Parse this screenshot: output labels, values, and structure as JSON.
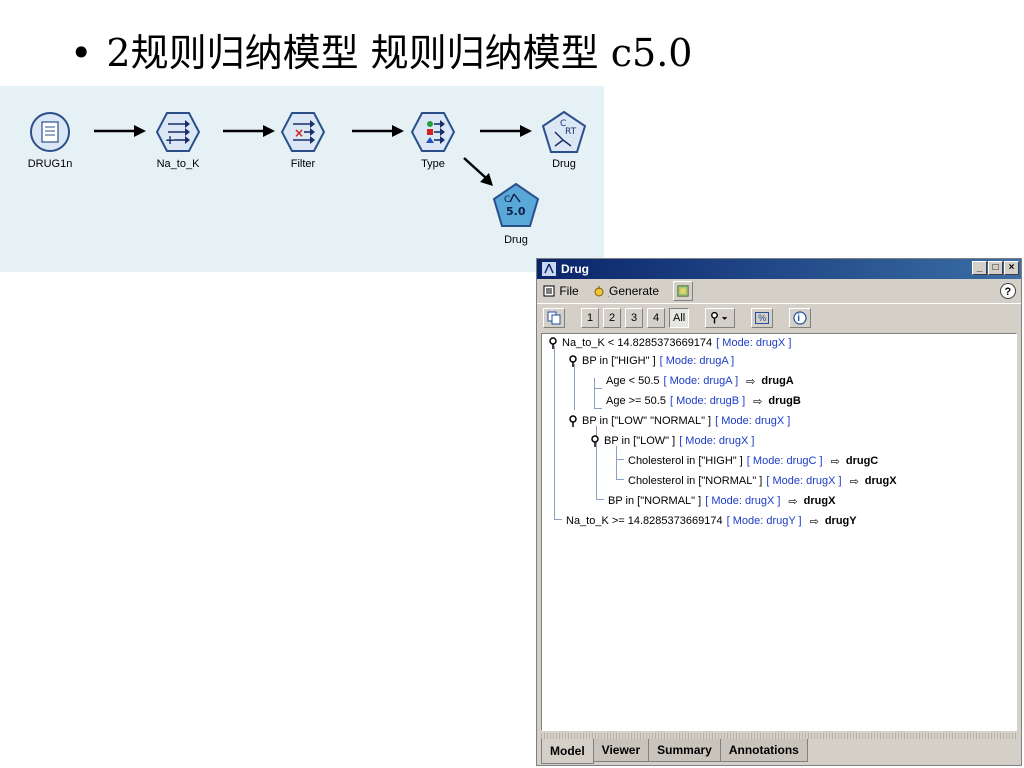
{
  "slide": {
    "bullet": "•",
    "title": "2规则归纳模型  规则归纳模型  c5.0"
  },
  "stream": {
    "nodes": [
      {
        "label": "DRUG1n",
        "icon": "source-file-icon"
      },
      {
        "label": "Na_to_K",
        "icon": "derive-icon"
      },
      {
        "label": "Filter",
        "icon": "filter-icon"
      },
      {
        "label": "Type",
        "icon": "type-icon"
      },
      {
        "label": "Drug",
        "icon": "cart-model-icon"
      },
      {
        "label": "Drug",
        "icon": "c50-model-icon"
      }
    ],
    "canvas_color": "#e6f1f5"
  },
  "window": {
    "title": "Drug",
    "buttons": {
      "minimize": "_",
      "maximize": "□",
      "close": "×"
    },
    "menu": {
      "file": "File",
      "file_key": "F",
      "generate": "Generate",
      "generate_key": "G"
    },
    "help": "?",
    "toolbar": {
      "levels": [
        "1",
        "2",
        "3",
        "4",
        "All"
      ],
      "active": "All",
      "percent": "%",
      "info": "i"
    },
    "tree": [
      {
        "cond": "Na_to_K < 14.8285373669174",
        "mode": "[ Mode: drugX ]",
        "result": ""
      },
      {
        "cond": "BP in [\"HIGH\" ]",
        "mode": "[ Mode: drugA ]",
        "result": ""
      },
      {
        "cond": "Age < 50.5",
        "mode": "[ Mode: drugA ]",
        "result": "drugA"
      },
      {
        "cond": "Age >= 50.5",
        "mode": "[ Mode: drugB ]",
        "result": "drugB"
      },
      {
        "cond": "BP in [\"LOW\" \"NORMAL\" ]",
        "mode": "[ Mode: drugX ]",
        "result": ""
      },
      {
        "cond": "BP in [\"LOW\" ]",
        "mode": "[ Mode: drugX ]",
        "result": ""
      },
      {
        "cond": "Cholesterol in [\"HIGH\" ]",
        "mode": "[ Mode: drugC ]",
        "result": "drugC"
      },
      {
        "cond": "Cholesterol in [\"NORMAL\" ]",
        "mode": "[ Mode: drugX ]",
        "result": "drugX"
      },
      {
        "cond": "BP in [\"NORMAL\" ]",
        "mode": "[ Mode: drugX ]",
        "result": "drugX"
      },
      {
        "cond": "Na_to_K >= 14.8285373669174",
        "mode": "[ Mode: drugY ]",
        "result": "drugY"
      }
    ],
    "result_arrow": "⇨",
    "tabs": [
      "Model",
      "Viewer",
      "Summary",
      "Annotations"
    ],
    "active_tab": "Model",
    "mode_color": "#1c3cc8"
  }
}
